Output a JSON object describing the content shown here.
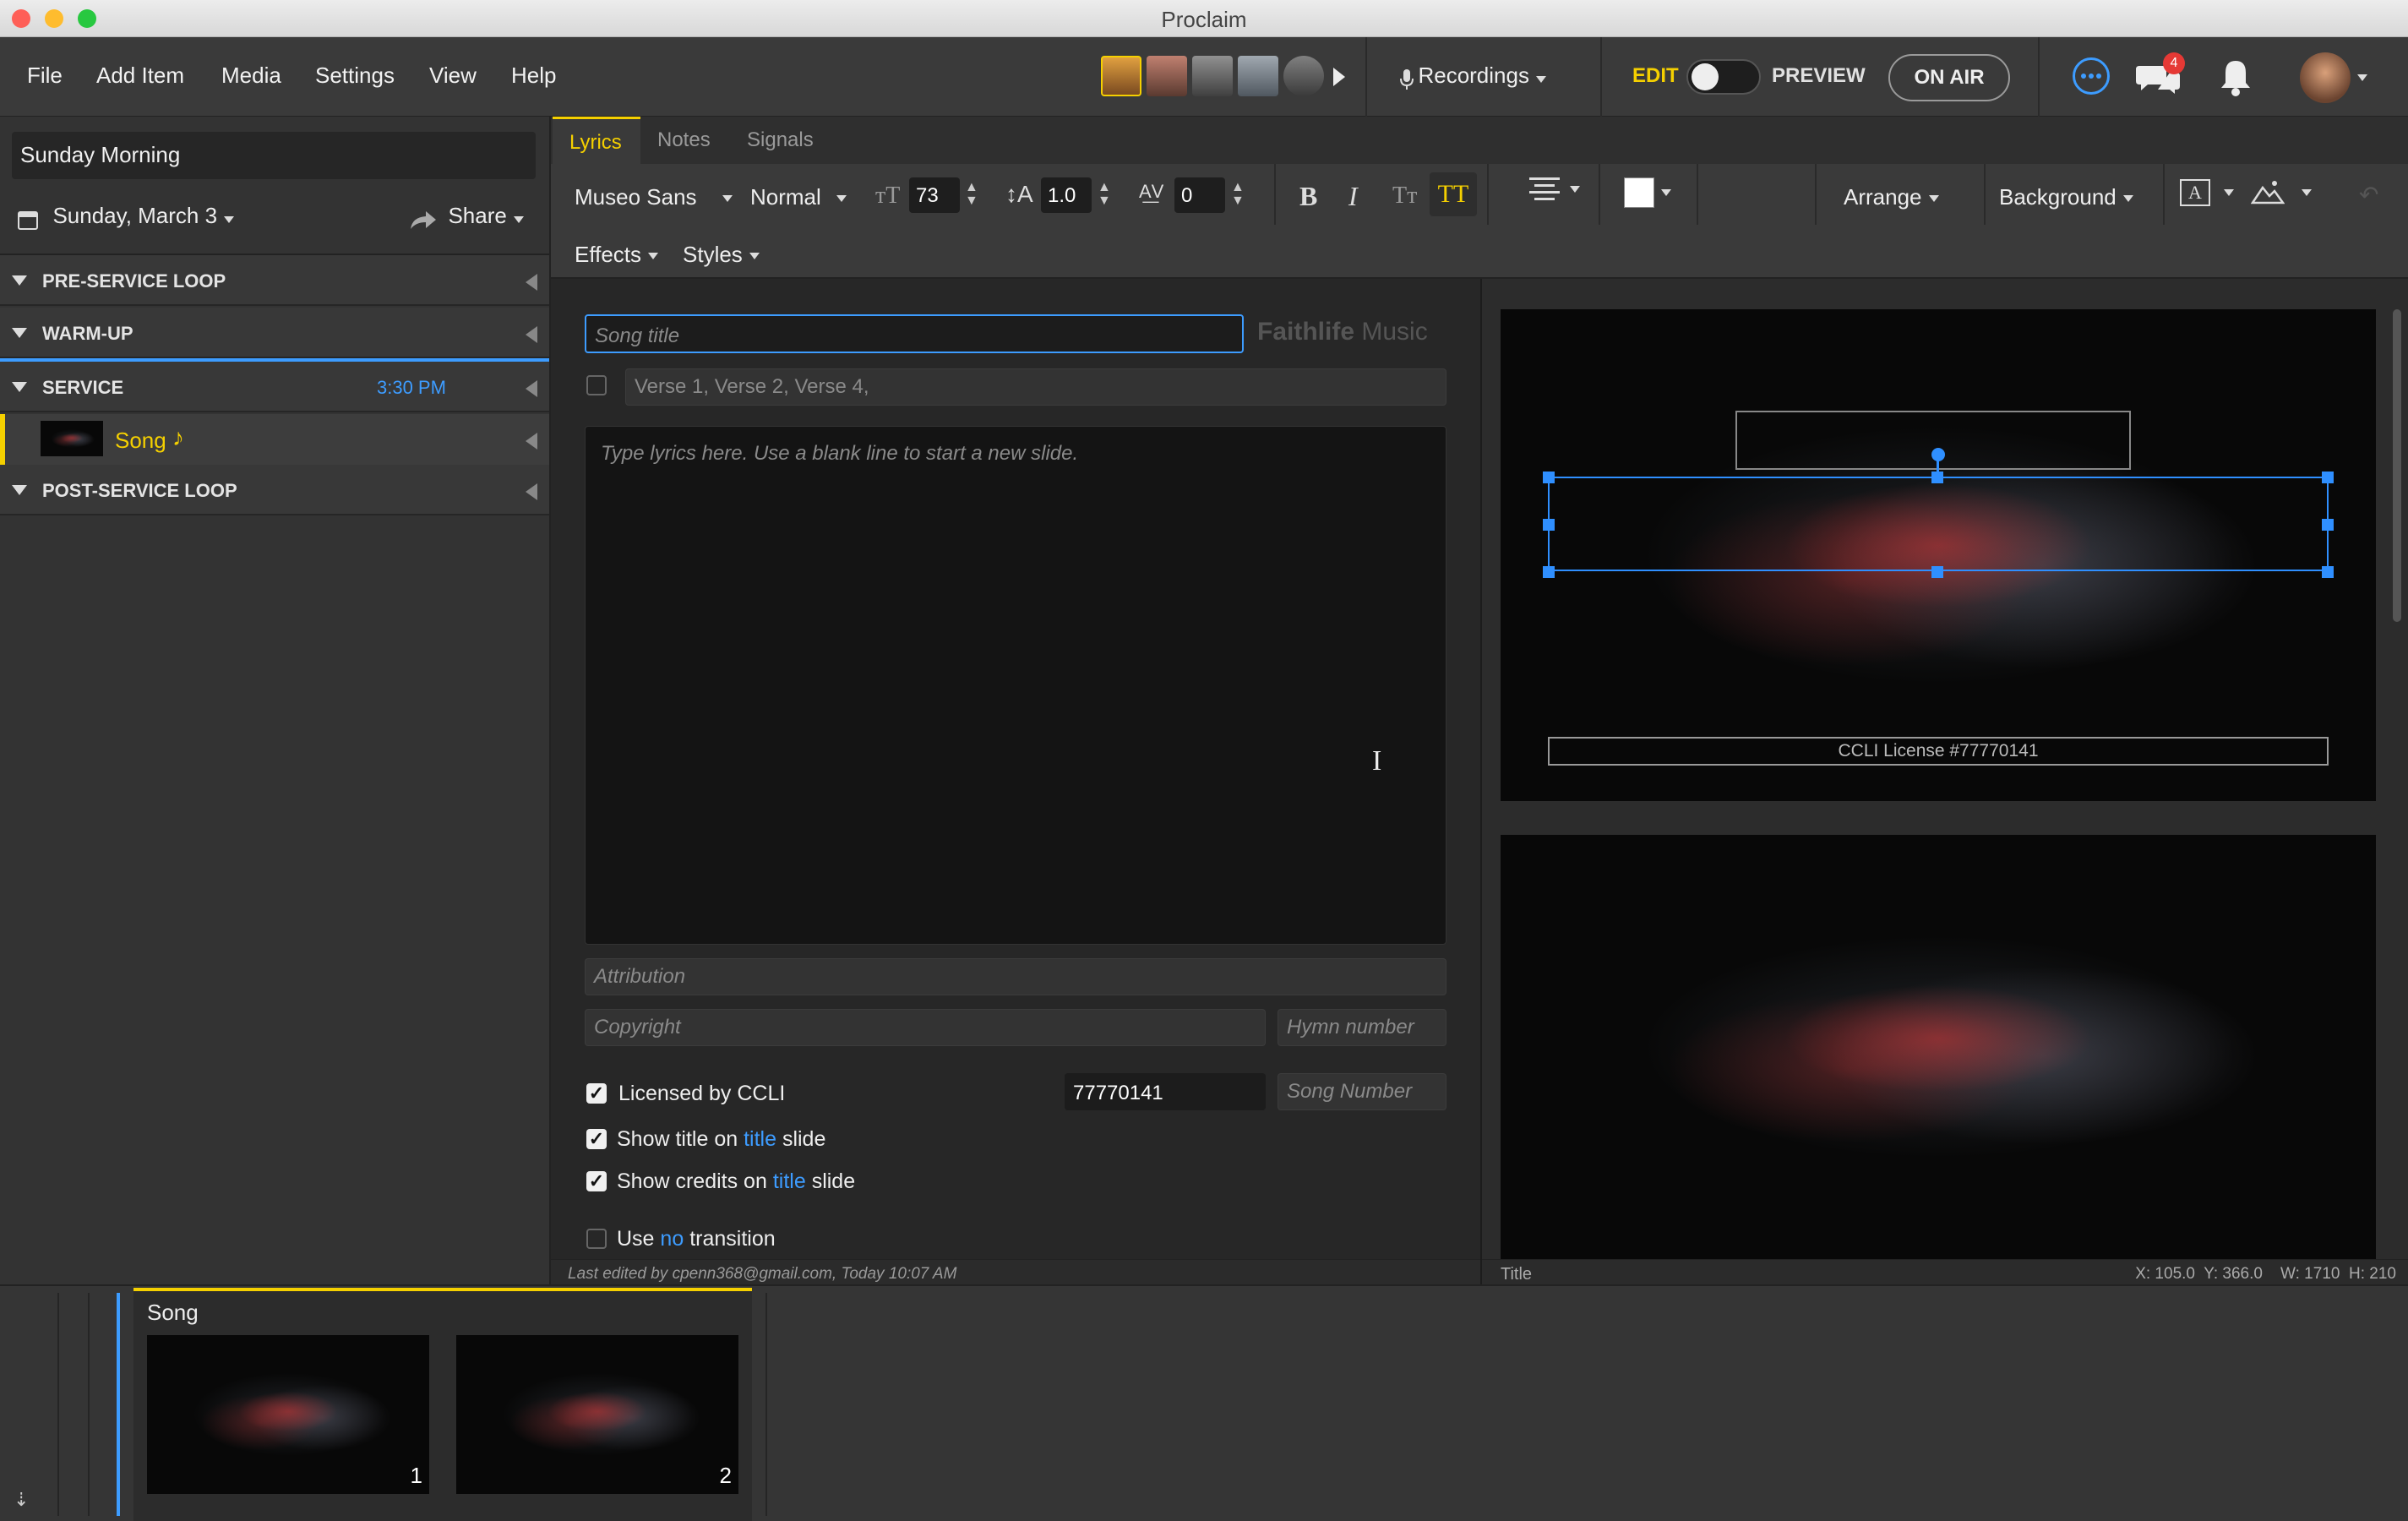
{
  "window": {
    "title": "Proclaim"
  },
  "menu": {
    "file": "File",
    "add_item": "Add Item",
    "media": "Media",
    "settings": "Settings",
    "view": "View",
    "help": "Help"
  },
  "toolbar": {
    "recordings": "Recordings",
    "edit": "EDIT",
    "preview": "PREVIEW",
    "on_air": "ON AIR",
    "chat_badge": "4"
  },
  "sidebar": {
    "presentation_title": "Sunday Morning",
    "date": "Sunday, March 3",
    "share": "Share",
    "sections": [
      {
        "label": "PRE-SERVICE LOOP"
      },
      {
        "label": "WARM-UP"
      },
      {
        "label": "SERVICE",
        "time": "3:30 PM"
      },
      {
        "label": "POST-SERVICE LOOP"
      }
    ],
    "item": {
      "label": "Song",
      "note": "♪"
    }
  },
  "editor": {
    "tabs": [
      "Lyrics",
      "Notes",
      "Signals"
    ],
    "font": "Museo Sans",
    "weight": "Normal",
    "font_size": "73",
    "line_height": "1.0",
    "tracking": "0",
    "arrange": "Arrange",
    "background": "Background",
    "effects": "Effects",
    "styles": "Styles",
    "song_title_placeholder": "Song title",
    "faithlife_brand": "Faithlife",
    "faithlife_music": "Music",
    "verses_placeholder": "Verse 1, Verse 2, Verse 4,",
    "lyrics_placeholder": "Type lyrics here. Use a blank line to start a new slide.",
    "attribution_placeholder": "Attribution",
    "copyright_placeholder": "Copyright",
    "hymn_placeholder": "Hymn number",
    "licensed_label": "Licensed by CCLI",
    "ccli_number": "77770141",
    "song_number_placeholder": "Song Number",
    "show_title_pre": "Show title on",
    "show_title_link": "title",
    "show_title_post": "slide",
    "show_credits_pre": "Show credits on",
    "show_credits_link": "title",
    "show_credits_post": "slide",
    "use_pre": "Use",
    "use_link": "no",
    "use_post": "transition",
    "last_edited": "Last edited by cpenn368@gmail.com, Today 10:07 AM"
  },
  "preview": {
    "ccli_text": "CCLI License #77770141",
    "status_left": "Title",
    "status_right": "X: 105.0  Y: 366.0    W: 1710  H: 210"
  },
  "strip": {
    "group_label": "Song",
    "slides": [
      {
        "number": "1"
      },
      {
        "number": "2"
      }
    ]
  },
  "colors": {
    "accent_yellow": "#f5d000",
    "accent_blue": "#3d9cff",
    "badge_red": "#e53935"
  }
}
